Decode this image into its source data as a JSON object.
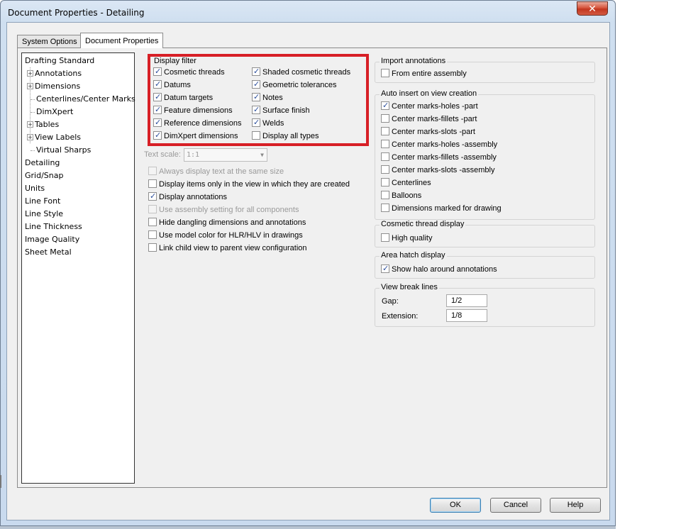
{
  "window": {
    "title": "Document Properties - Detailing",
    "close_glyph": "✕"
  },
  "tabs": [
    {
      "label": "System Options",
      "active": false
    },
    {
      "label": "Document Properties",
      "active": true
    }
  ],
  "tree": {
    "items": [
      {
        "label": "Drafting Standard",
        "expandable": false,
        "indent": 0
      },
      {
        "label": "Annotations",
        "expandable": true,
        "indent": 1
      },
      {
        "label": "Dimensions",
        "expandable": true,
        "indent": 1
      },
      {
        "label": "Centerlines/Center Marks",
        "expandable": false,
        "indent": 1
      },
      {
        "label": "DimXpert",
        "expandable": false,
        "indent": 1
      },
      {
        "label": "Tables",
        "expandable": true,
        "indent": 1
      },
      {
        "label": "View Labels",
        "expandable": true,
        "indent": 1
      },
      {
        "label": "Virtual Sharps",
        "expandable": false,
        "indent": 1
      },
      {
        "label": "Detailing",
        "expandable": false,
        "indent": 0,
        "selected": true
      },
      {
        "label": "Grid/Snap",
        "expandable": false,
        "indent": 0
      },
      {
        "label": "Units",
        "expandable": false,
        "indent": 0
      },
      {
        "label": "Line Font",
        "expandable": false,
        "indent": 0
      },
      {
        "label": "Line Style",
        "expandable": false,
        "indent": 0
      },
      {
        "label": "Line Thickness",
        "expandable": false,
        "indent": 0
      },
      {
        "label": "Image Quality",
        "expandable": false,
        "indent": 0
      },
      {
        "label": "Sheet Metal",
        "expandable": false,
        "indent": 0
      }
    ]
  },
  "display_filter": {
    "title": "Display filter",
    "left": [
      {
        "label": "Cosmetic threads",
        "checked": true
      },
      {
        "label": "Datums",
        "checked": true
      },
      {
        "label": "Datum targets",
        "checked": true
      },
      {
        "label": "Feature dimensions",
        "checked": true
      },
      {
        "label": "Reference dimensions",
        "checked": true
      },
      {
        "label": "DimXpert dimensions",
        "checked": true
      }
    ],
    "right": [
      {
        "label": "Shaded cosmetic threads",
        "checked": true
      },
      {
        "label": "Geometric tolerances",
        "checked": true
      },
      {
        "label": "Notes",
        "checked": true
      },
      {
        "label": "Surface finish",
        "checked": true
      },
      {
        "label": "Welds",
        "checked": true
      },
      {
        "label": "Display all types",
        "checked": false
      }
    ]
  },
  "text_scale": {
    "label": "Text scale:",
    "value": "1:1",
    "enabled": false
  },
  "options": [
    {
      "label": "Always display text at the same size",
      "checked": false,
      "enabled": false
    },
    {
      "label": "Display items only in the view in which they are created",
      "checked": false,
      "enabled": true
    },
    {
      "label": "Display annotations",
      "checked": true,
      "enabled": true
    },
    {
      "label": "Use assembly setting for all components",
      "checked": false,
      "enabled": false
    },
    {
      "label": "Hide dangling dimensions and annotations",
      "checked": false,
      "enabled": true
    },
    {
      "label": "Use model color for HLR/HLV in drawings",
      "checked": false,
      "enabled": true
    },
    {
      "label": "Link child view to parent view configuration",
      "checked": false,
      "enabled": true
    }
  ],
  "import_annotations": {
    "title": "Import annotations",
    "items": [
      {
        "label": "From entire assembly",
        "checked": false
      }
    ]
  },
  "auto_insert": {
    "title": "Auto insert on view creation",
    "items": [
      {
        "label": "Center marks-holes -part",
        "checked": true
      },
      {
        "label": "Center marks-fillets -part",
        "checked": false
      },
      {
        "label": "Center marks-slots  -part",
        "checked": false
      },
      {
        "label": "Center marks-holes -assembly",
        "checked": false
      },
      {
        "label": "Center marks-fillets -assembly",
        "checked": false
      },
      {
        "label": "Center marks-slots  -assembly",
        "checked": false
      },
      {
        "label": "Centerlines",
        "checked": false
      },
      {
        "label": "Balloons",
        "checked": false
      },
      {
        "label": "Dimensions marked for drawing",
        "checked": false
      }
    ]
  },
  "cosmetic_thread_display": {
    "title": "Cosmetic thread display",
    "items": [
      {
        "label": "High quality",
        "checked": false
      }
    ]
  },
  "area_hatch_display": {
    "title": "Area hatch display",
    "items": [
      {
        "label": "Show halo around annotations",
        "checked": true
      }
    ]
  },
  "view_break_lines": {
    "title": "View break lines",
    "gap_label": "Gap:",
    "gap_value": "1/2",
    "extension_label": "Extension:",
    "extension_value": "1/8"
  },
  "buttons": {
    "ok": "OK",
    "cancel": "Cancel",
    "help": "Help"
  },
  "colors": {
    "highlight_border": "#d71f26",
    "check_mark": "#2b4e9c"
  }
}
